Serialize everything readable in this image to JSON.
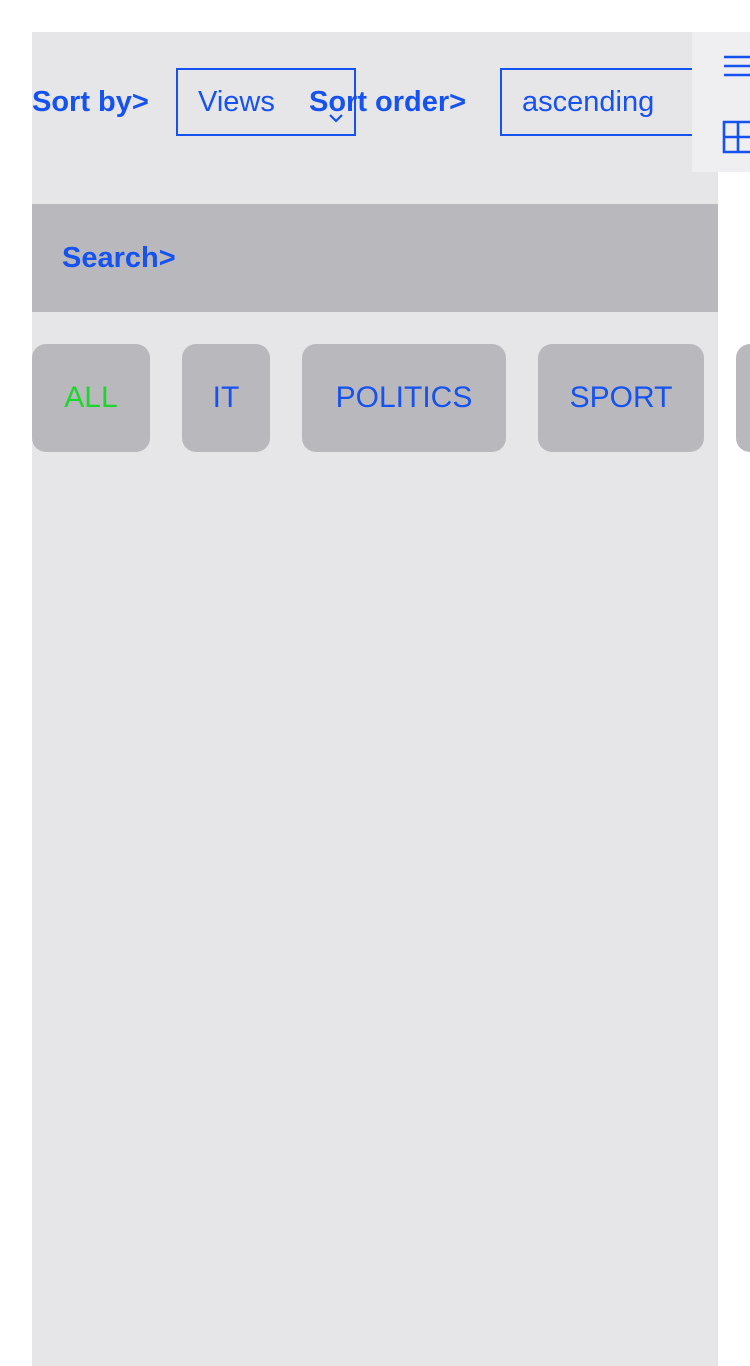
{
  "sort": {
    "by_label": "Sort by>",
    "by_value": "Views",
    "order_label": "Sort order>",
    "order_value": "ascending"
  },
  "search": {
    "label": "Search>"
  },
  "categories": [
    {
      "label": "ALL",
      "active": true
    },
    {
      "label": "IT",
      "active": false
    },
    {
      "label": "POLITICS",
      "active": false
    },
    {
      "label": "SPORT",
      "active": false
    }
  ],
  "tools": {
    "list_icon": "list-view-icon",
    "grid_icon": "grid-view-icon"
  },
  "colors": {
    "accent": "#1652f0",
    "active_category": "#1dd62d",
    "panel_bg": "#e6e6e9",
    "bar_bg": "#b9b9bd"
  }
}
